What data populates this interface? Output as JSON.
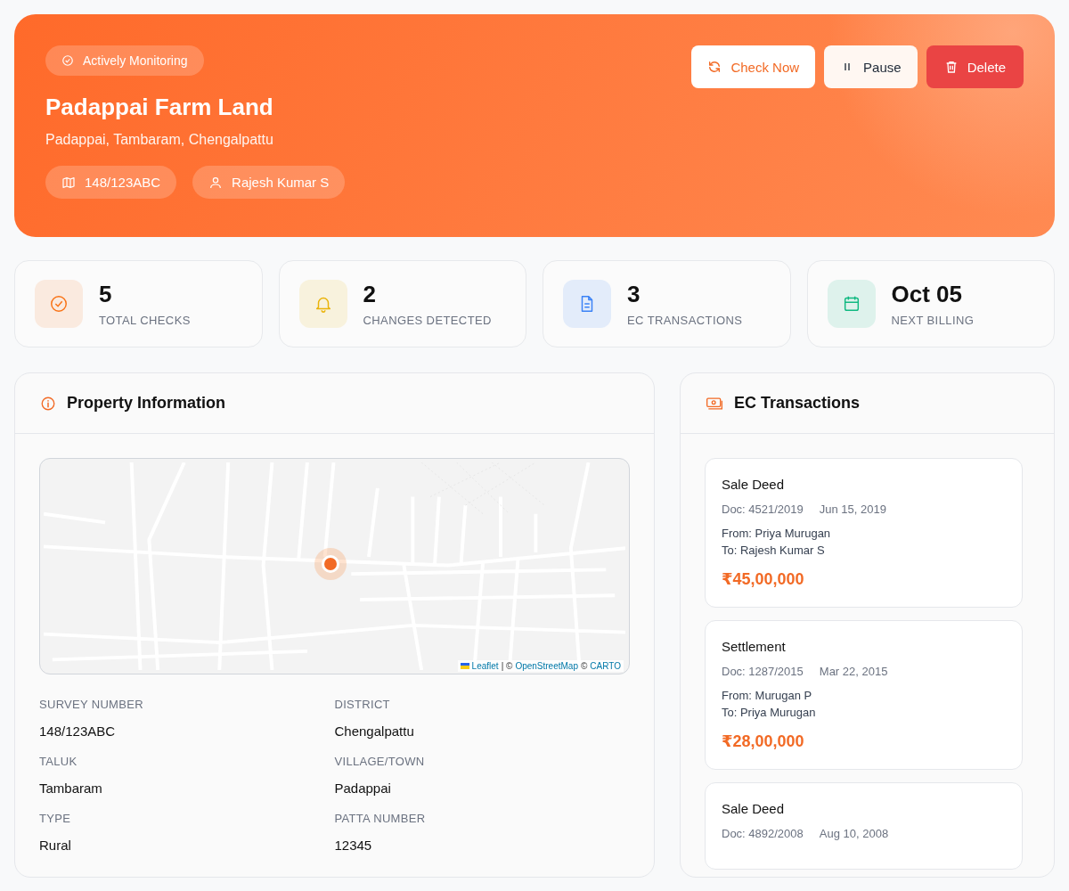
{
  "header": {
    "status": {
      "label": "Actively Monitoring",
      "active": true
    },
    "title": "Padappai Farm Land",
    "location": "Padappai, Tambaram, Chengalpattu",
    "chips": [
      {
        "kind": "map",
        "label": "148/123ABC"
      },
      {
        "kind": "person",
        "label": "Rajesh Kumar S"
      }
    ],
    "actions": [
      {
        "kind": "refresh",
        "label": "Check Now"
      },
      {
        "kind": "pause",
        "label": "Pause"
      },
      {
        "kind": "delete",
        "label": "Delete"
      }
    ]
  },
  "stats": [
    {
      "kind": "check",
      "color": "#f97316",
      "value": "5",
      "label": "TOTAL CHECKS"
    },
    {
      "kind": "bell",
      "color": "#eab308",
      "value": "2",
      "label": "CHANGES DETECTED"
    },
    {
      "kind": "document",
      "color": "#3b82f6",
      "value": "3",
      "label": "EC TRANSACTIONS"
    },
    {
      "kind": "calendar",
      "color": "#10b981",
      "value": "Oct 05",
      "label": "NEXT BILLING"
    }
  ],
  "property": {
    "title": "Property Information",
    "map": {
      "attribution": [
        {
          "kind": "link",
          "text": "Leaflet"
        },
        {
          "kind": "text",
          "text": "| ©"
        },
        {
          "kind": "link",
          "text": "OpenStreetMap"
        },
        {
          "kind": "text",
          "text": "©"
        },
        {
          "kind": "link",
          "text": "CARTO"
        }
      ]
    },
    "fields": [
      {
        "label": "SURVEY NUMBER",
        "value": "148/123ABC"
      },
      {
        "label": "DISTRICT",
        "value": "Chengalpattu"
      },
      {
        "label": "TALUK",
        "value": "Tambaram"
      },
      {
        "label": "VILLAGE/TOWN",
        "value": "Padappai"
      },
      {
        "label": "TYPE",
        "value": "Rural"
      },
      {
        "label": "PATTA NUMBER",
        "value": "12345"
      }
    ]
  },
  "transactions": {
    "title": "EC Transactions",
    "items": [
      {
        "type": "Sale Deed",
        "doc": "Doc: 4521/2019",
        "date": "Jun 15, 2019",
        "from": "From: Priya Murugan",
        "to": "To: Rajesh Kumar S",
        "amount": "₹45,00,000"
      },
      {
        "type": "Settlement",
        "doc": "Doc: 1287/2015",
        "date": "Mar 22, 2015",
        "from": "From: Murugan P",
        "to": "To: Priya Murugan",
        "amount": "₹28,00,000"
      },
      {
        "type": "Sale Deed",
        "doc": "Doc: 4892/2008",
        "date": "Aug 10, 2008"
      }
    ]
  }
}
